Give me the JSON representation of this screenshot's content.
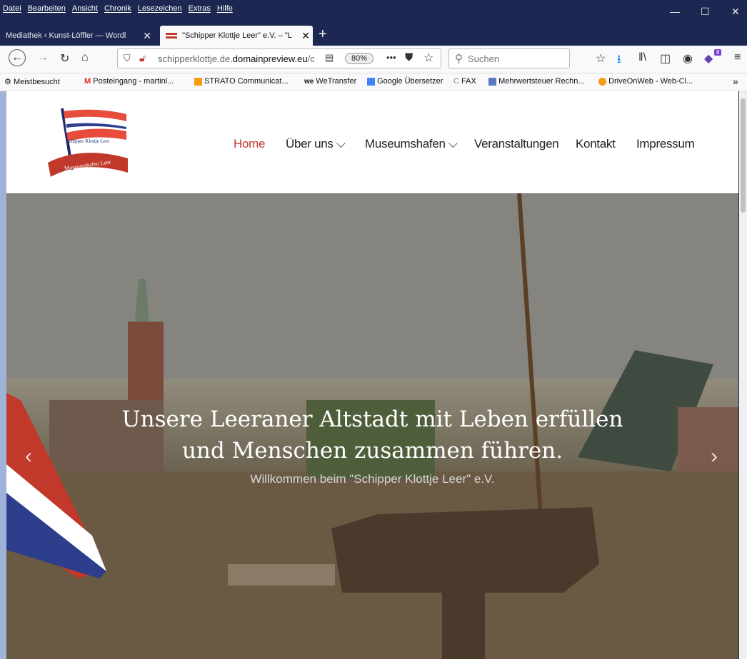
{
  "menubar": {
    "items": [
      "Datei",
      "Bearbeiten",
      "Ansicht",
      "Chronik",
      "Lesezeichen",
      "Extras",
      "Hilfe"
    ]
  },
  "window_controls": {
    "minimize": "—",
    "maximize": "☐",
    "close": "✕"
  },
  "tabs": [
    {
      "label": "Mediathek ‹ Kunst-Löffler — Wordl"
    },
    {
      "label": "\"Schipper Klottje Leer\" e.V. – \"L"
    }
  ],
  "navbar": {
    "url_domain": "schipperklottje.de.",
    "url_highlight": "domainpreview.eu",
    "url_tail": "/c",
    "zoom": "80%",
    "search_placeholder": "Suchen",
    "badge_count": "8"
  },
  "bookmarks": [
    "Meistbesucht",
    "Posteingang - martinl...",
    "STRATO Communicat...",
    "WeTransfer",
    "Google Übersetzer",
    "FAX",
    "Mehrwertsteuer Rechn...",
    "DriveOnWeb - Web-Cl..."
  ],
  "site": {
    "logo_text_top": "Schipper Klottje Leer",
    "logo_text_bottom": "Museumshafen Leer",
    "nav": [
      "Home",
      "Über uns ⌵",
      "Museumshafen ⌵",
      "Veranstaltungen",
      "Kontakt",
      "Impressum"
    ]
  },
  "hero": {
    "title_line1": "Unsere Leeraner Altstadt mit Leben erfüllen",
    "title_line2": "und Menschen zusammen führen.",
    "subtitle": "Willkommen beim \"Schipper Klottje Leer\" e.V."
  },
  "colors": {
    "chrome_dark": "#1d2852",
    "nav_active": "#c0392b"
  }
}
